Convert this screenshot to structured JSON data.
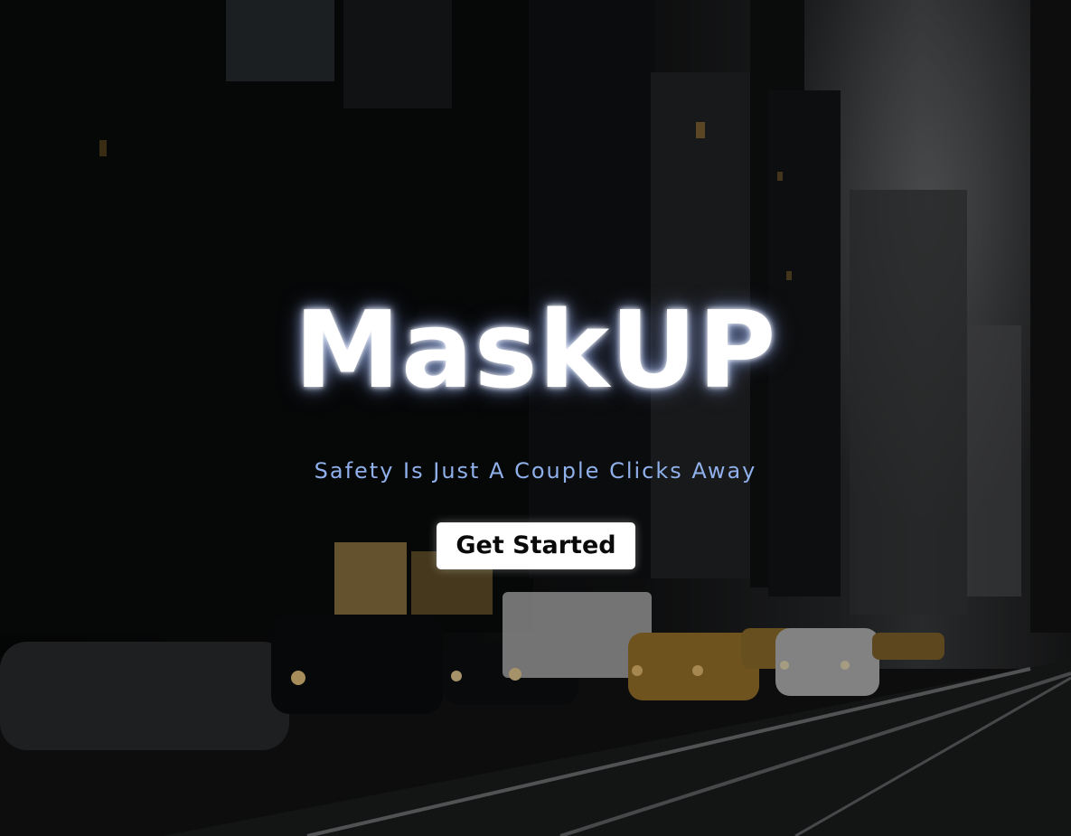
{
  "hero": {
    "title": "MaskUP",
    "subtitle": "Safety Is Just A Couple Clicks Away",
    "cta_label": "Get Started"
  },
  "background": {
    "scene": "city-street-night-photo"
  },
  "colors": {
    "title": "#ffffff",
    "subtitle": "#8fb0ea",
    "button_bg": "#ffffff",
    "button_text": "#0a0a0a"
  }
}
